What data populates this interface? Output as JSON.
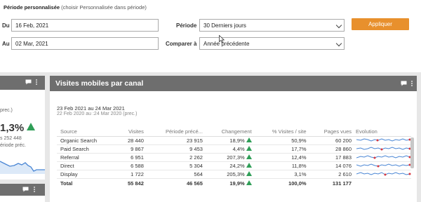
{
  "filter": {
    "title": "Période personnalisée",
    "title_hint": "(choisir Personnalisée dans période)",
    "from_label": "Du",
    "from_value": "16 Feb, 2021",
    "to_label": "Au",
    "to_value": "02 Mar, 2021",
    "period_label": "Période",
    "period_value": "30 Derniers jours",
    "compare_label": "Comparer à",
    "compare_value": "Année précédente",
    "apply_label": "Appliquer"
  },
  "left_card": {
    "txt1": "prec.)",
    "big": "1,3%",
    "txt2": "s 252 448",
    "txt3": "ériode préc."
  },
  "main_card": {
    "title": "Visites mobiles par canal",
    "date_current": "23 Feb 2021 au  24 Mar 2021",
    "date_prev": "22 Feb 2020 au :24 Mar 2020 (prec.)",
    "columns": [
      "Source",
      "Visites",
      "Période précé...",
      "Changement",
      "% Visites / site",
      "Pages vues",
      "Evolution"
    ],
    "rows": [
      {
        "source": "Organic Search",
        "visites": "28 440",
        "prev": "23 915",
        "change": "18,9%",
        "pct": "50,9%",
        "pages": "60 200"
      },
      {
        "source": "Paid Search",
        "visites": "9 867",
        "prev": "9 453",
        "change": "4,4%",
        "pct": "17,7%",
        "pages": "28 860"
      },
      {
        "source": "Referral",
        "visites": "6 951",
        "prev": "2 262",
        "change": "207,3%",
        "pct": "12,4%",
        "pages": "17 883"
      },
      {
        "source": "Direct",
        "visites": "6 588",
        "prev": "5 304",
        "change": "24,2%",
        "pct": "11,8%",
        "pages": "14 076"
      },
      {
        "source": "Display",
        "visites": "1 722",
        "prev": "564",
        "change": "205,3%",
        "pct": "3,1%",
        "pages": "2 610"
      }
    ],
    "total": {
      "source": "Total",
      "visites": "55 842",
      "prev": "46 565",
      "change": "19,9%",
      "pct": "100,0%",
      "pages": "131 177"
    }
  },
  "colors": {
    "accent": "#e8902d",
    "header": "#6e6e6e",
    "up": "#2f9e57",
    "spark": "#4a86d4",
    "spark_dot": "#d9363e"
  },
  "icons": [
    "chevron-down-icon",
    "comment-icon",
    "more-vertical-icon",
    "triangle-up-icon",
    "cursor-icon"
  ]
}
